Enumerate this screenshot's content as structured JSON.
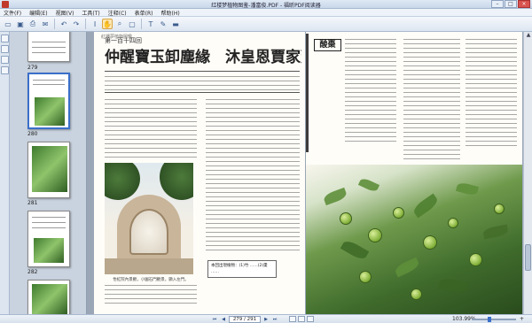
{
  "window": {
    "title": "红楼梦植物图鉴-潘富俊.PDF - 福昕PDF阅读器",
    "minimize": "–",
    "maximize": "□",
    "close": "×"
  },
  "menu": [
    "文件(F)",
    "编辑(E)",
    "视图(V)",
    "工具(T)",
    "注释(C)",
    "表单(R)",
    "帮助(H)"
  ],
  "toolbar": {
    "icons": [
      "open-icon",
      "save-icon",
      "print-icon",
      "email-icon",
      "undo-icon",
      "redo-icon",
      "select-icon",
      "hand-icon",
      "zoom-icon",
      "snapshot-icon",
      "text-icon",
      "note-icon",
      "highlight-icon"
    ]
  },
  "thumbnails": [
    {
      "label": "279"
    },
    {
      "label": "280"
    },
    {
      "label": "281"
    },
    {
      "label": "282"
    }
  ],
  "page_left": {
    "running_head": "紅樓夢植物圖鑑",
    "chapter": "第一百十四回",
    "title": "仲醒寶玉卸塵緣　沐皇恩賈家延世澤",
    "caption": "怡紅院內景觀，小園石門觀景，顯入左門。",
    "note": "本回出現植物：(1)竹 ……(2)棗 ……"
  },
  "page_right": {
    "plant_name": "酸棗"
  },
  "status": {
    "first": "⏮",
    "prev": "◀",
    "page": "279 / 291",
    "next": "▶",
    "last": "⏭",
    "zoom": "103.99%",
    "zoom_minus": "−",
    "zoom_plus": "+"
  }
}
